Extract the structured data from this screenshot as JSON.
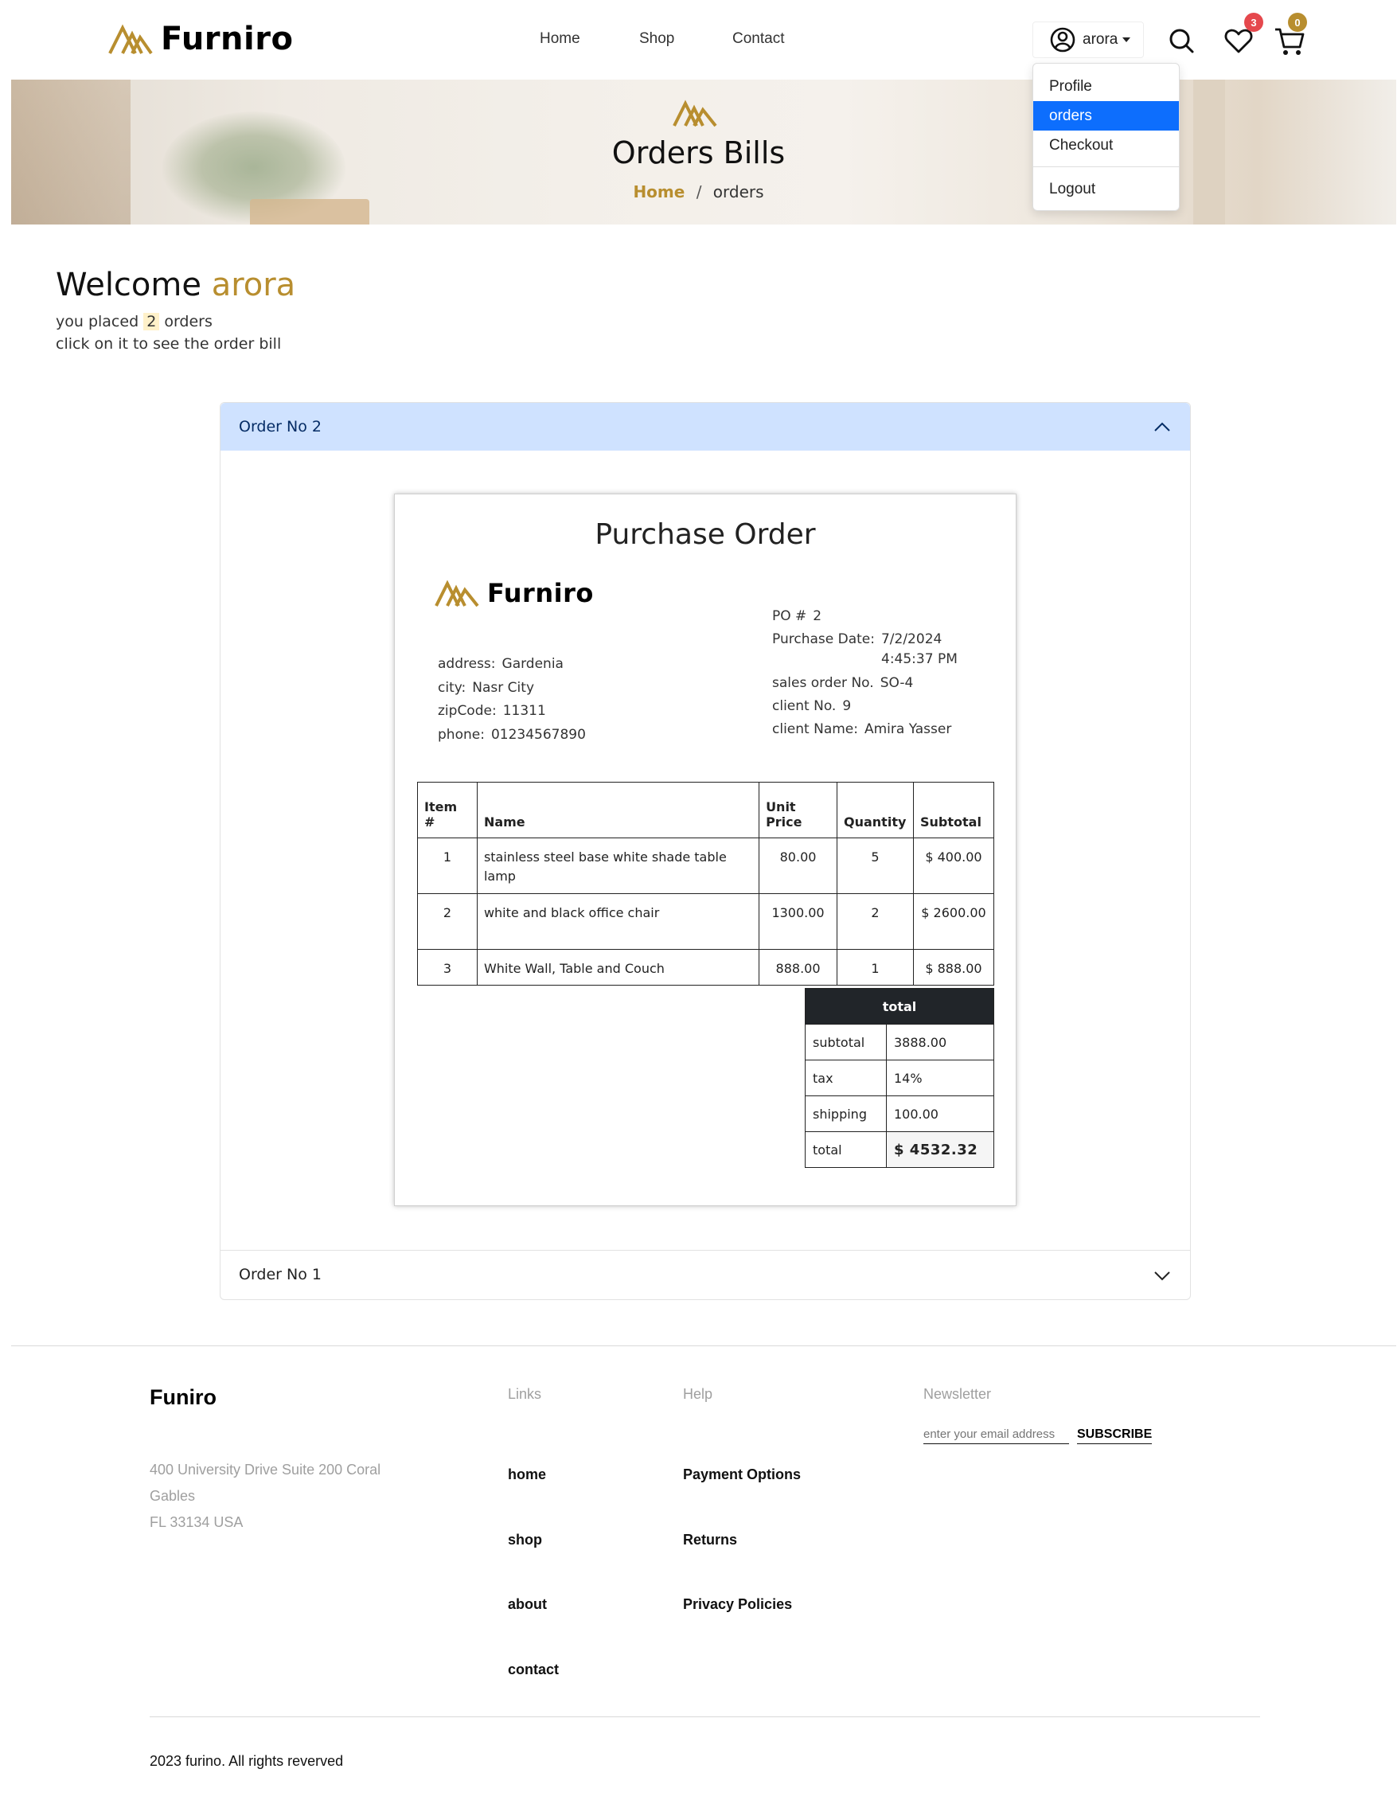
{
  "header": {
    "brand": "Furniro",
    "nav": [
      {
        "label": "Home"
      },
      {
        "label": "Shop"
      },
      {
        "label": "Contact"
      }
    ],
    "user": {
      "name": "arora"
    },
    "wishlist_count": "3",
    "cart_count": "0",
    "dropdown": {
      "items": [
        {
          "label": "Profile"
        },
        {
          "label": "orders",
          "active": true
        },
        {
          "label": "Checkout"
        }
      ],
      "logout": "Logout"
    }
  },
  "banner": {
    "title": "Orders Bills",
    "breadcrumb": {
      "home": "Home",
      "separator": "/",
      "current": "orders"
    }
  },
  "welcome": {
    "greeting": "Welcome",
    "username": "arora",
    "placed_prefix": "you placed",
    "order_count": "2",
    "placed_suffix": "orders",
    "hint": "click on it to see the order bill"
  },
  "accordion": {
    "open_title": "Order No 2",
    "closed_title": "Order No 1"
  },
  "purchase_order": {
    "title": "Purchase Order",
    "brand": "Furniro",
    "company": {
      "address_label": "address:",
      "address": "Gardenia",
      "city_label": "city:",
      "city": "Nasr City",
      "zip_label": "zipCode:",
      "zip": "11311",
      "phone_label": "phone:",
      "phone": "01234567890"
    },
    "meta": {
      "po_label": "PO #",
      "po": "2",
      "date_label": "Purchase Date:",
      "date": "7/2/2024",
      "time": "4:45:37 PM",
      "so_label": "sales order No.",
      "so": "SO-4",
      "client_no_label": "client No.",
      "client_no": "9",
      "client_name_label": "client Name:",
      "client_name": "Amira Yasser"
    },
    "table": {
      "headers": {
        "item": "Item",
        "item2": "#",
        "name": "Name",
        "price": "Unit",
        "price2": "Price",
        "qty": "Quantity",
        "subtotal": "Subtotal"
      },
      "rows": [
        {
          "no": "1",
          "name": "stainless steel base white shade table lamp",
          "price": "80.00",
          "qty": "5",
          "subtotal": "$ 400.00"
        },
        {
          "no": "2",
          "name": "white and black office chair",
          "price": "1300.00",
          "qty": "2",
          "subtotal": "$ 2600.00"
        },
        {
          "no": "3",
          "name": "White Wall, Table and Couch",
          "price": "888.00",
          "qty": "1",
          "subtotal": "$ 888.00"
        }
      ]
    },
    "totals": {
      "header": "total",
      "subtotal_label": "subtotal",
      "subtotal": "3888.00",
      "tax_label": "tax",
      "tax": "14%",
      "shipping_label": "shipping",
      "shipping": "100.00",
      "total_label": "total",
      "total": "$ 4532.32"
    }
  },
  "footer": {
    "brand": "Funiro",
    "address_line1": "400 University Drive Suite 200 Coral",
    "address_line2": "Gables",
    "address_line3": "FL 33134 USA",
    "links_head": "Links",
    "links": [
      "home",
      "shop",
      "about",
      "contact"
    ],
    "help_head": "Help",
    "help": [
      "Payment Options",
      "Returns",
      "Privacy Policies"
    ],
    "newsletter_head": "Newsletter",
    "email_placeholder": "enter your email address",
    "subscribe": "SUBSCRIBE",
    "copyright": "2023 furino. All rights reverved"
  },
  "colors": {
    "accent": "#b88e2f",
    "dropdown_active": "#0d6efd",
    "accordion_open": "#cfe2ff",
    "wishlist_badge": "#e5484d",
    "cart_badge": "#b88e2f"
  }
}
